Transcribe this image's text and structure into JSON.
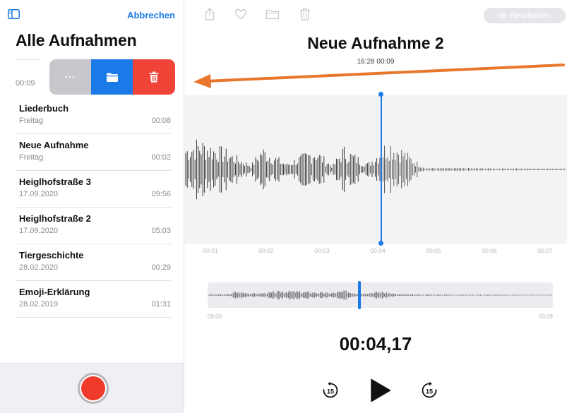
{
  "sidebar": {
    "cancel_label": "Abbrechen",
    "title": "Alle Aufnahmen",
    "swiped_item": {
      "duration": "00:09"
    },
    "swipe_actions": {
      "more_label": "···"
    },
    "items": [
      {
        "name": "Liederbuch",
        "date": "Freitag",
        "duration": "00:08"
      },
      {
        "name": "Neue Aufnahme",
        "date": "Freitag",
        "duration": "00:02"
      },
      {
        "name": "Heiglhofstraße 3",
        "date": "17.09.2020",
        "duration": "09:56"
      },
      {
        "name": "Heiglhofstraße 2",
        "date": "17.09.2020",
        "duration": "05:03"
      },
      {
        "name": "Tiergeschichte",
        "date": "28.02.2020",
        "duration": "00:29"
      },
      {
        "name": "Emoji-Erklärung",
        "date": "28.02.2019",
        "duration": "01:31"
      }
    ]
  },
  "toolbar": {
    "edit_label": "Bearbeiten",
    "icons": [
      "share-icon",
      "heart-icon",
      "folder-icon",
      "trash-icon"
    ]
  },
  "recording": {
    "title": "Neue Aufnahme 2",
    "subtitle": "16:28  00:09",
    "current_time": "00:04,17"
  },
  "timeline": {
    "ticks": [
      "00:01",
      "00:02",
      "00:03",
      "00:04",
      "00:05",
      "00:06",
      "00:07"
    ],
    "overview_start": "00:00",
    "overview_end": "00:09"
  },
  "controls": {
    "skip_back_label": "15",
    "skip_forward_label": "15"
  },
  "colors": {
    "accent": "#1a7ae8",
    "delete": "#f04438",
    "more": "#c7c7cc",
    "record": "#f03a2c",
    "annotation_arrow": "#e8762d"
  }
}
